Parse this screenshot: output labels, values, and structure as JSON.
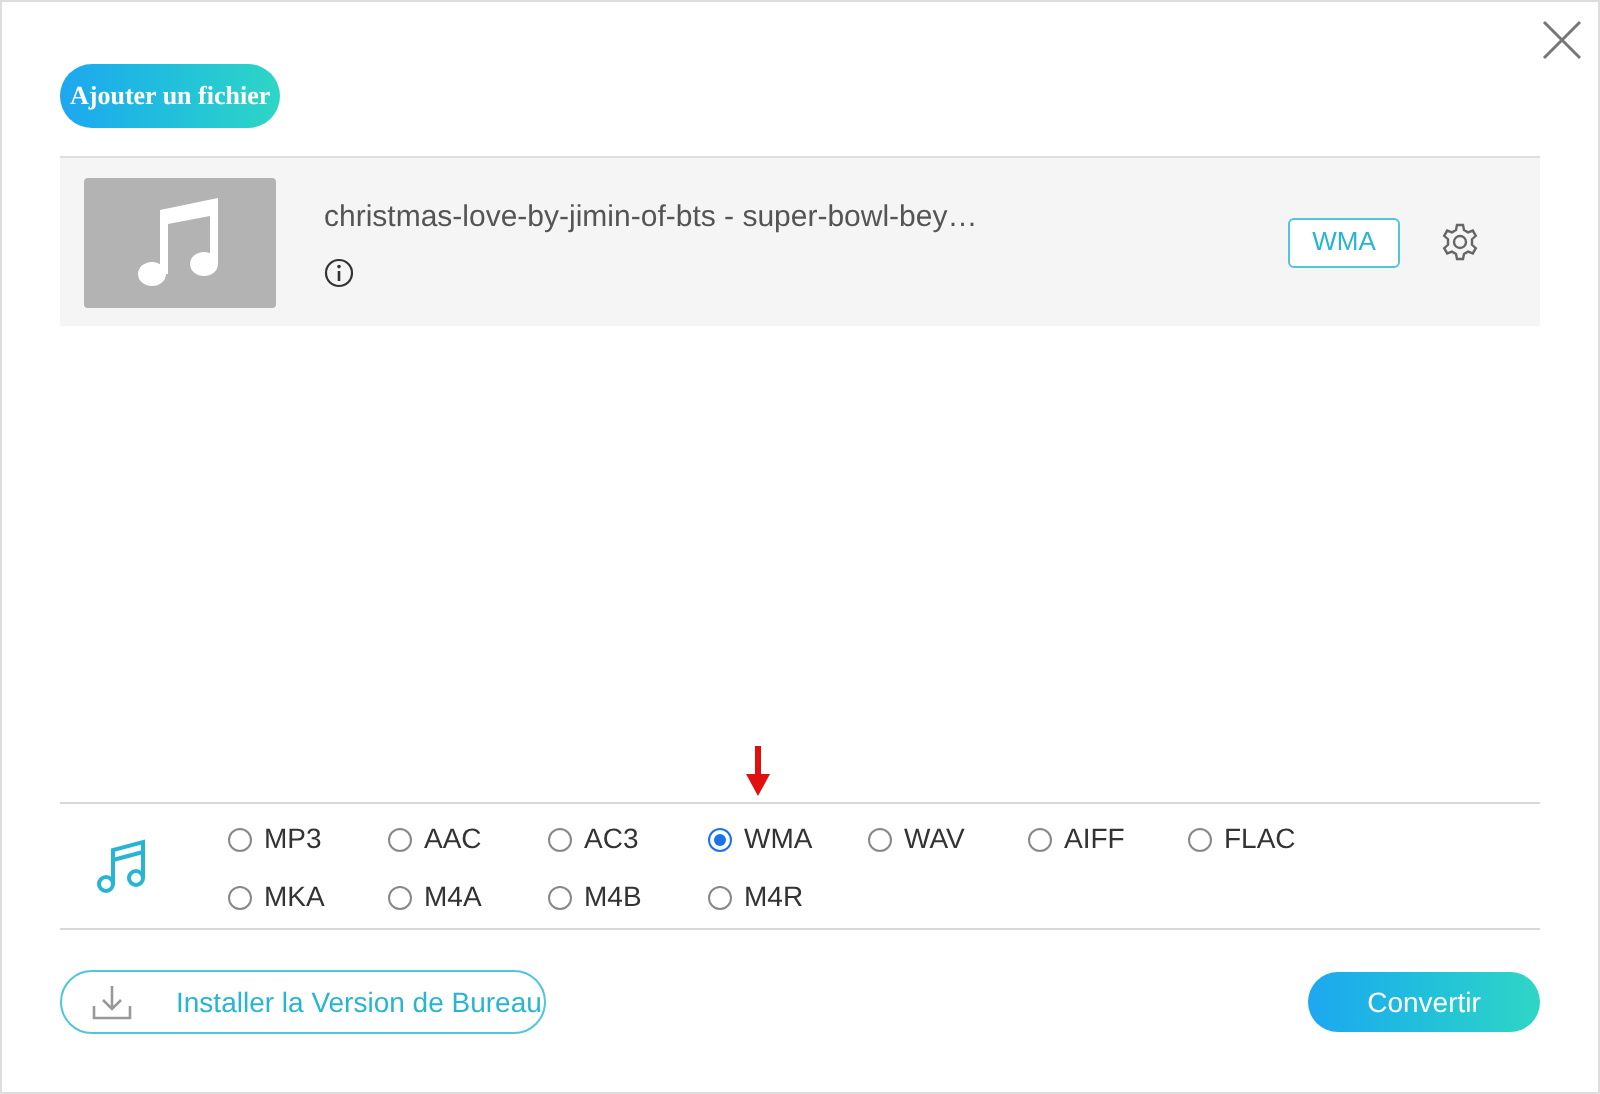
{
  "add_button": "Ajouter un fichier",
  "files": [
    {
      "name": "christmas-love-by-jimin-of-bts - super-bowl-bey…",
      "format": "WMA"
    }
  ],
  "formats": [
    {
      "label": "MP3",
      "selected": false
    },
    {
      "label": "AAC",
      "selected": false
    },
    {
      "label": "AC3",
      "selected": false
    },
    {
      "label": "WMA",
      "selected": true
    },
    {
      "label": "WAV",
      "selected": false
    },
    {
      "label": "AIFF",
      "selected": false
    },
    {
      "label": "FLAC",
      "selected": false
    },
    {
      "label": "MKA",
      "selected": false
    },
    {
      "label": "M4A",
      "selected": false
    },
    {
      "label": "M4B",
      "selected": false
    },
    {
      "label": "M4R",
      "selected": false
    }
  ],
  "install_button": "Installer la Version de Bureau",
  "convert_button": "Convertir"
}
